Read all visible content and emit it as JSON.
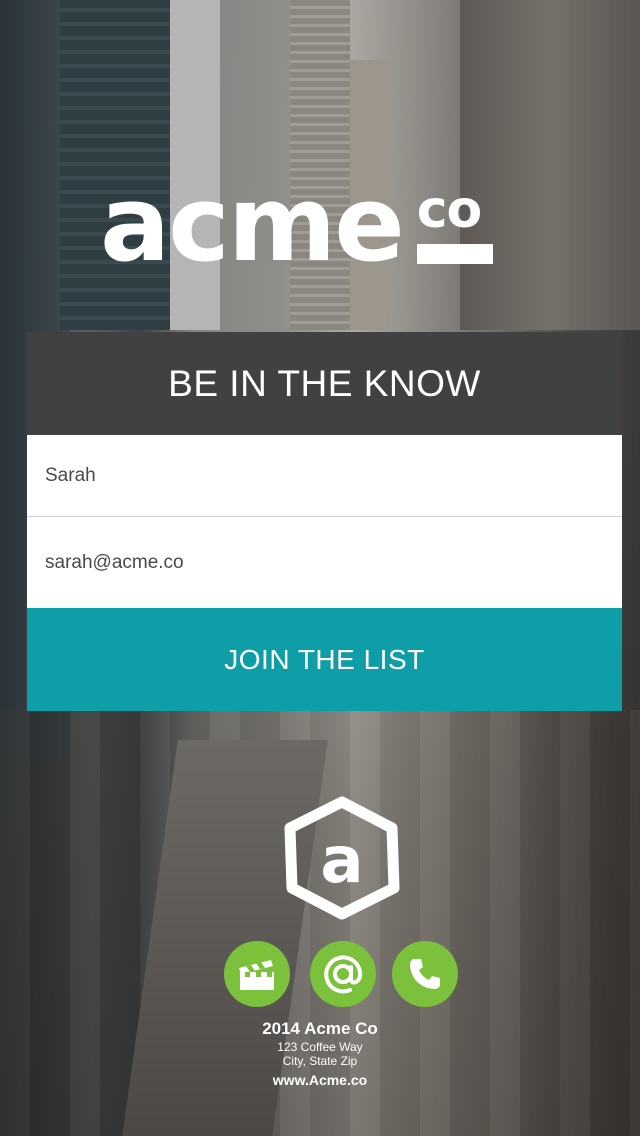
{
  "brand": {
    "logo_main": "acme",
    "logo_suffix": "co"
  },
  "signup": {
    "title": "BE IN THE KNOW",
    "name_value": "Sarah",
    "email_value": "sarah@acme.co",
    "submit_label": "JOIN THE LIST"
  },
  "emblem": {
    "letter": "a"
  },
  "social": {
    "items": [
      {
        "icon": "clapperboard-icon",
        "color": "#7cc13c"
      },
      {
        "icon": "at-sign-icon",
        "color": "#7cc13c"
      },
      {
        "icon": "phone-icon",
        "color": "#7cc13c"
      }
    ]
  },
  "footer": {
    "company": "2014 Acme Co",
    "street": "123 Coffee Way",
    "city": "City, State Zip",
    "website": "www.Acme.co"
  },
  "colors": {
    "header": "#414141",
    "accent": "#0e9ea7",
    "social": "#7cc13c"
  }
}
